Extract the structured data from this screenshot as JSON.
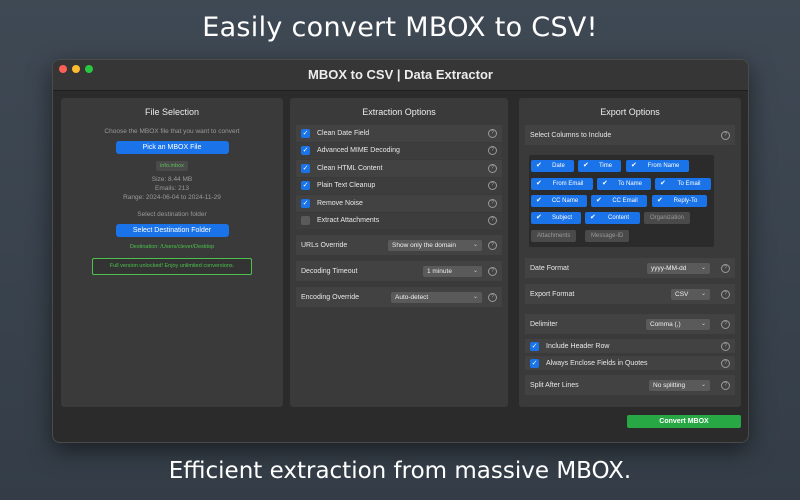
{
  "headline_top": "Easily convert MBOX to CSV!",
  "headline_bottom": "Efficient extraction from massive MBOX.",
  "window": {
    "title": "MBOX to CSV | Data Extractor"
  },
  "file_selection": {
    "title": "File Selection",
    "choose_text": "Choose the MBOX file that you want to convert",
    "pick_button": "Pick an MBOX File",
    "file_name": "info.mbox",
    "size": "Size: 8.44 MB",
    "emails": "Emails: 213",
    "range": "Range: 2024-06-04 to 2024-11-29",
    "dest_text": "Select destination folder",
    "dest_button": "Select Destination Folder",
    "destination": "Destination: /Users/clever/Desktop",
    "unlock": "Full version unlocked! Enjoy unlimited conversions."
  },
  "extraction": {
    "title": "Extraction Options",
    "options": [
      {
        "label": "Clean Date Field",
        "checked": true
      },
      {
        "label": "Advanced MIME Decoding",
        "checked": true
      },
      {
        "label": "Clean HTML Content",
        "checked": true
      },
      {
        "label": "Plain Text Cleanup",
        "checked": true
      },
      {
        "label": "Remove Noise",
        "checked": true
      },
      {
        "label": "Extract Attachments",
        "checked": false
      }
    ],
    "urls_override": {
      "label": "URLs Override",
      "value": "Show only the domain"
    },
    "decoding_timeout": {
      "label": "Decoding Timeout",
      "value": "1 minute"
    },
    "encoding_override": {
      "label": "Encoding Override",
      "value": "Auto-detect"
    }
  },
  "export": {
    "title": "Export Options",
    "select_columns": "Select Columns to Include",
    "columns": [
      {
        "label": "Date",
        "on": true
      },
      {
        "label": "Time",
        "on": true
      },
      {
        "label": "From Name",
        "on": true
      },
      {
        "label": "From Email",
        "on": true
      },
      {
        "label": "To Name",
        "on": true
      },
      {
        "label": "To Email",
        "on": true
      },
      {
        "label": "CC Name",
        "on": true
      },
      {
        "label": "CC Email",
        "on": true
      },
      {
        "label": "Reply-To",
        "on": true
      },
      {
        "label": "Subject",
        "on": true
      },
      {
        "label": "Content",
        "on": true
      },
      {
        "label": "Organization",
        "on": false
      },
      {
        "label": "Attachments",
        "on": false
      },
      {
        "label": "Message-ID",
        "on": false
      }
    ],
    "date_format": {
      "label": "Date Format",
      "value": "yyyy-MM-dd"
    },
    "export_format": {
      "label": "Export Format",
      "value": "CSV"
    },
    "delimiter": {
      "label": "Delimiter",
      "value": "Comma (,)"
    },
    "include_header": {
      "label": "Include Header Row",
      "checked": true
    },
    "enclose_quotes": {
      "label": "Always Enclose Fields in Quotes",
      "checked": true
    },
    "split_after": {
      "label": "Split After Lines",
      "value": "No splitting"
    }
  },
  "convert_button": "Convert MBOX",
  "colors": {
    "accent": "#1a73e8",
    "success": "#27a844",
    "unlock": "#4cc24c"
  }
}
